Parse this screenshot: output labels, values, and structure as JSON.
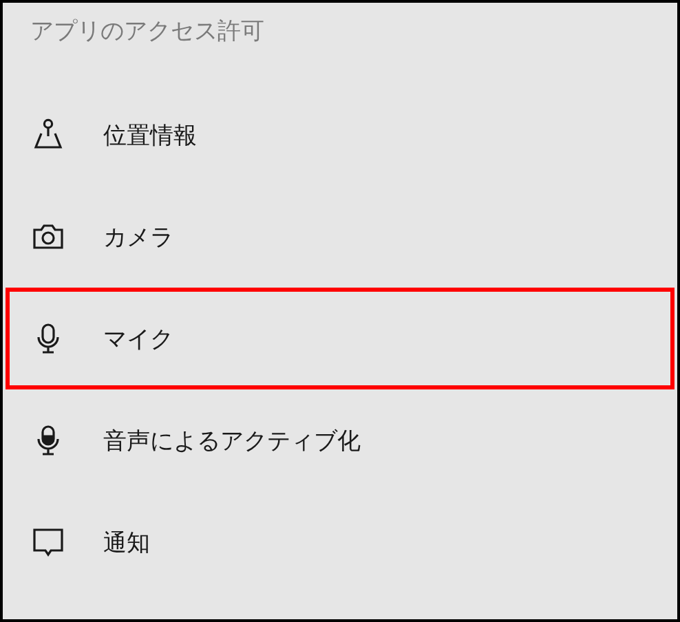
{
  "heading": "アプリのアクセス許可",
  "items": [
    {
      "label": "位置情報",
      "kind": "location",
      "selected": false
    },
    {
      "label": "カメラ",
      "kind": "camera",
      "selected": false
    },
    {
      "label": "マイク",
      "kind": "microphone",
      "selected": true
    },
    {
      "label": "音声によるアクティブ化",
      "kind": "voice",
      "selected": false
    },
    {
      "label": "通知",
      "kind": "notification",
      "selected": false
    }
  ]
}
